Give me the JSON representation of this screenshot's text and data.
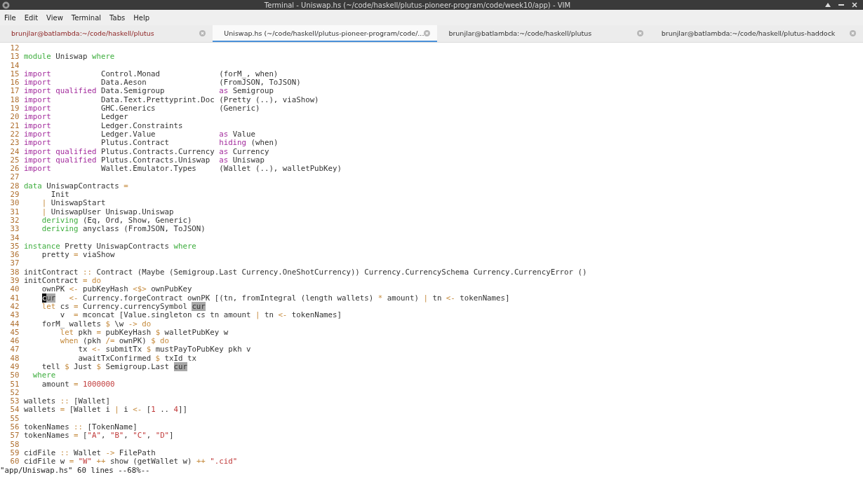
{
  "window": {
    "title": "Terminal - Uniswap.hs (~/code/haskell/plutus-pioneer-program/code/week10/app) - VIM"
  },
  "menu": [
    "File",
    "Edit",
    "View",
    "Terminal",
    "Tabs",
    "Help"
  ],
  "tabs": [
    {
      "label": "brunjlar@batlambda:~/code/haskell/plutus",
      "selected": false,
      "alert": true
    },
    {
      "label": "Uniswap.hs (~/code/haskell/plutus-pioneer-program/code/...",
      "selected": true,
      "alert": false
    },
    {
      "label": "brunjlar@batlambda:~/code/haskell/plutus",
      "selected": false,
      "alert": false
    },
    {
      "label": "brunjlar@batlambda:~/code/haskell/plutus-haddock",
      "selected": false,
      "alert": false
    }
  ],
  "lines": [
    {
      "n": "12"
    },
    {
      "n": "13",
      "segs": [
        {
          "kind": "decl",
          "text": "module"
        },
        {
          "kind": "plain",
          "text": " Uniswap "
        },
        {
          "kind": "decl",
          "text": "where"
        }
      ]
    },
    {
      "n": "14"
    },
    {
      "n": "15",
      "segs": [
        {
          "kind": "keyword",
          "text": "import"
        },
        {
          "kind": "plain",
          "text": "           Control.Monad             (forM_, when)"
        }
      ]
    },
    {
      "n": "16",
      "segs": [
        {
          "kind": "keyword",
          "text": "import"
        },
        {
          "kind": "plain",
          "text": "           Data.Aeson                (FromJSON, ToJSON)"
        }
      ]
    },
    {
      "n": "17",
      "segs": [
        {
          "kind": "keyword",
          "text": "import qualified"
        },
        {
          "kind": "plain",
          "text": " Data.Semigroup            "
        },
        {
          "kind": "keyword",
          "text": "as"
        },
        {
          "kind": "plain",
          "text": " Semigroup"
        }
      ]
    },
    {
      "n": "18",
      "segs": [
        {
          "kind": "keyword",
          "text": "import"
        },
        {
          "kind": "plain",
          "text": "           Data.Text.Prettyprint.Doc (Pretty (..), viaShow)"
        }
      ]
    },
    {
      "n": "19",
      "segs": [
        {
          "kind": "keyword",
          "text": "import"
        },
        {
          "kind": "plain",
          "text": "           GHC.Generics              (Generic)"
        }
      ]
    },
    {
      "n": "20",
      "segs": [
        {
          "kind": "keyword",
          "text": "import"
        },
        {
          "kind": "plain",
          "text": "           Ledger"
        }
      ]
    },
    {
      "n": "21",
      "segs": [
        {
          "kind": "keyword",
          "text": "import"
        },
        {
          "kind": "plain",
          "text": "           Ledger.Constraints"
        }
      ]
    },
    {
      "n": "22",
      "segs": [
        {
          "kind": "keyword",
          "text": "import"
        },
        {
          "kind": "plain",
          "text": "           Ledger.Value              "
        },
        {
          "kind": "keyword",
          "text": "as"
        },
        {
          "kind": "plain",
          "text": " Value"
        }
      ]
    },
    {
      "n": "23",
      "segs": [
        {
          "kind": "keyword",
          "text": "import"
        },
        {
          "kind": "plain",
          "text": "           Plutus.Contract           "
        },
        {
          "kind": "keyword",
          "text": "hiding"
        },
        {
          "kind": "plain",
          "text": " (when)"
        }
      ]
    },
    {
      "n": "24",
      "segs": [
        {
          "kind": "keyword",
          "text": "import qualified"
        },
        {
          "kind": "plain",
          "text": " Plutus.Contracts.Currency "
        },
        {
          "kind": "keyword",
          "text": "as"
        },
        {
          "kind": "plain",
          "text": " Currency"
        }
      ]
    },
    {
      "n": "25",
      "segs": [
        {
          "kind": "keyword",
          "text": "import qualified"
        },
        {
          "kind": "plain",
          "text": " Plutus.Contracts.Uniswap  "
        },
        {
          "kind": "keyword",
          "text": "as"
        },
        {
          "kind": "plain",
          "text": " Uniswap"
        }
      ]
    },
    {
      "n": "26",
      "segs": [
        {
          "kind": "keyword",
          "text": "import"
        },
        {
          "kind": "plain",
          "text": "           Wallet.Emulator.Types     (Wallet (..), walletPubKey)"
        }
      ]
    },
    {
      "n": "27"
    },
    {
      "n": "28",
      "segs": [
        {
          "kind": "decl",
          "text": "data"
        },
        {
          "kind": "plain",
          "text": " UniswapContracts "
        },
        {
          "kind": "op",
          "text": "="
        }
      ]
    },
    {
      "n": "29",
      "segs": [
        {
          "kind": "plain",
          "text": "      Init"
        }
      ]
    },
    {
      "n": "30",
      "segs": [
        {
          "kind": "op",
          "text": "    |"
        },
        {
          "kind": "plain",
          "text": " UniswapStart"
        }
      ]
    },
    {
      "n": "31",
      "segs": [
        {
          "kind": "op",
          "text": "    |"
        },
        {
          "kind": "plain",
          "text": " UniswapUser Uniswap.Uniswap"
        }
      ]
    },
    {
      "n": "32",
      "segs": [
        {
          "kind": "decl",
          "text": "    deriving"
        },
        {
          "kind": "plain",
          "text": " (Eq, Ord, Show, Generic)"
        }
      ]
    },
    {
      "n": "33",
      "segs": [
        {
          "kind": "decl",
          "text": "    deriving"
        },
        {
          "kind": "plain",
          "text": " anyclass (FromJSON, ToJSON)"
        }
      ]
    },
    {
      "n": "34"
    },
    {
      "n": "35",
      "segs": [
        {
          "kind": "decl",
          "text": "instance"
        },
        {
          "kind": "plain",
          "text": " Pretty UniswapContracts "
        },
        {
          "kind": "decl",
          "text": "where"
        }
      ]
    },
    {
      "n": "36",
      "segs": [
        {
          "kind": "plain",
          "text": "    pretty "
        },
        {
          "kind": "op",
          "text": "="
        },
        {
          "kind": "plain",
          "text": " viaShow"
        }
      ]
    },
    {
      "n": "37"
    },
    {
      "n": "38",
      "segs": [
        {
          "kind": "plain",
          "text": "initContract "
        },
        {
          "kind": "op",
          "text": "::"
        },
        {
          "kind": "plain",
          "text": " Contract (Maybe (Semigroup.Last Currency.OneShotCurrency)) Currency.CurrencySchema Currency.CurrencyError ()"
        }
      ]
    },
    {
      "n": "39",
      "segs": [
        {
          "kind": "plain",
          "text": "initContract "
        },
        {
          "kind": "op",
          "text": "= do"
        }
      ]
    },
    {
      "n": "40",
      "segs": [
        {
          "kind": "plain",
          "text": "    ownPK "
        },
        {
          "kind": "op",
          "text": "<-"
        },
        {
          "kind": "plain",
          "text": " pubKeyHash "
        },
        {
          "kind": "op",
          "text": "<$>"
        },
        {
          "kind": "plain",
          "text": " ownPubKey"
        }
      ]
    },
    {
      "n": "41",
      "indent": true,
      "segs": [
        {
          "kind": "cursor",
          "text": "c"
        },
        {
          "kind": "match",
          "text": "ur"
        },
        {
          "kind": "op",
          "text": "   <-"
        },
        {
          "kind": "plain",
          "text": " Currency.forgeContract ownPK [(tn, fromIntegral (length wallets) "
        },
        {
          "kind": "op",
          "text": "*"
        },
        {
          "kind": "plain",
          "text": " amount) "
        },
        {
          "kind": "op",
          "text": "|"
        },
        {
          "kind": "plain",
          "text": " tn "
        },
        {
          "kind": "op",
          "text": "<-"
        },
        {
          "kind": "plain",
          "text": " tokenNames]"
        }
      ]
    },
    {
      "n": "42",
      "segs": [
        {
          "kind": "op",
          "text": "    let"
        },
        {
          "kind": "plain",
          "text": " cs "
        },
        {
          "kind": "op",
          "text": "="
        },
        {
          "kind": "plain",
          "text": " Currency.currencySymbol "
        },
        {
          "kind": "match",
          "text": "cur"
        }
      ]
    },
    {
      "n": "43",
      "segs": [
        {
          "kind": "plain",
          "text": "        v  "
        },
        {
          "kind": "op",
          "text": "="
        },
        {
          "kind": "plain",
          "text": " mconcat [Value.singleton cs tn amount "
        },
        {
          "kind": "op",
          "text": "|"
        },
        {
          "kind": "plain",
          "text": " tn "
        },
        {
          "kind": "op",
          "text": "<-"
        },
        {
          "kind": "plain",
          "text": " tokenNames]"
        }
      ]
    },
    {
      "n": "44",
      "segs": [
        {
          "kind": "plain",
          "text": "    forM_ wallets "
        },
        {
          "kind": "op",
          "text": "$"
        },
        {
          "kind": "plain",
          "text": " \\w "
        },
        {
          "kind": "op",
          "text": "-> do"
        }
      ]
    },
    {
      "n": "45",
      "segs": [
        {
          "kind": "op",
          "text": "        let"
        },
        {
          "kind": "plain",
          "text": " pkh "
        },
        {
          "kind": "op",
          "text": "="
        },
        {
          "kind": "plain",
          "text": " pubKeyHash "
        },
        {
          "kind": "op",
          "text": "$"
        },
        {
          "kind": "plain",
          "text": " walletPubKey w"
        }
      ]
    },
    {
      "n": "46",
      "segs": [
        {
          "kind": "op",
          "text": "        when"
        },
        {
          "kind": "plain",
          "text": " (pkh "
        },
        {
          "kind": "op",
          "text": "/="
        },
        {
          "kind": "plain",
          "text": " ownPK) "
        },
        {
          "kind": "op",
          "text": "$ do"
        }
      ]
    },
    {
      "n": "47",
      "segs": [
        {
          "kind": "plain",
          "text": "            tx "
        },
        {
          "kind": "op",
          "text": "<-"
        },
        {
          "kind": "plain",
          "text": " submitTx "
        },
        {
          "kind": "op",
          "text": "$"
        },
        {
          "kind": "plain",
          "text": " mustPayToPubKey pkh v"
        }
      ]
    },
    {
      "n": "48",
      "segs": [
        {
          "kind": "plain",
          "text": "            awaitTxConfirmed "
        },
        {
          "kind": "op",
          "text": "$"
        },
        {
          "kind": "plain",
          "text": " txId tx"
        }
      ]
    },
    {
      "n": "49",
      "segs": [
        {
          "kind": "plain",
          "text": "    tell "
        },
        {
          "kind": "op",
          "text": "$"
        },
        {
          "kind": "plain",
          "text": " Just "
        },
        {
          "kind": "op",
          "text": "$"
        },
        {
          "kind": "plain",
          "text": " Semigroup.Last "
        },
        {
          "kind": "match",
          "text": "cur"
        }
      ]
    },
    {
      "n": "50",
      "segs": [
        {
          "kind": "decl",
          "text": "  where"
        }
      ]
    },
    {
      "n": "51",
      "segs": [
        {
          "kind": "plain",
          "text": "    amount "
        },
        {
          "kind": "op",
          "text": "="
        },
        {
          "kind": "literal",
          "text": " 1000000"
        }
      ]
    },
    {
      "n": "52"
    },
    {
      "n": "53",
      "segs": [
        {
          "kind": "plain",
          "text": "wallets "
        },
        {
          "kind": "op",
          "text": "::"
        },
        {
          "kind": "plain",
          "text": " [Wallet]"
        }
      ]
    },
    {
      "n": "54",
      "segs": [
        {
          "kind": "plain",
          "text": "wallets "
        },
        {
          "kind": "op",
          "text": "="
        },
        {
          "kind": "plain",
          "text": " [Wallet i "
        },
        {
          "kind": "op",
          "text": "|"
        },
        {
          "kind": "plain",
          "text": " i "
        },
        {
          "kind": "op",
          "text": "<-"
        },
        {
          "kind": "plain",
          "text": " ["
        },
        {
          "kind": "literal",
          "text": "1"
        },
        {
          "kind": "plain",
          "text": " .. "
        },
        {
          "kind": "literal",
          "text": "4"
        },
        {
          "kind": "plain",
          "text": "]]"
        }
      ]
    },
    {
      "n": "55"
    },
    {
      "n": "56",
      "segs": [
        {
          "kind": "plain",
          "text": "tokenNames "
        },
        {
          "kind": "op",
          "text": "::"
        },
        {
          "kind": "plain",
          "text": " [TokenName]"
        }
      ]
    },
    {
      "n": "57",
      "segs": [
        {
          "kind": "plain",
          "text": "tokenNames "
        },
        {
          "kind": "op",
          "text": "="
        },
        {
          "kind": "plain",
          "text": " ["
        },
        {
          "kind": "literal",
          "text": "\"A\""
        },
        {
          "kind": "plain",
          "text": ", "
        },
        {
          "kind": "literal",
          "text": "\"B\""
        },
        {
          "kind": "plain",
          "text": ", "
        },
        {
          "kind": "literal",
          "text": "\"C\""
        },
        {
          "kind": "plain",
          "text": ", "
        },
        {
          "kind": "literal",
          "text": "\"D\""
        },
        {
          "kind": "plain",
          "text": "]"
        }
      ]
    },
    {
      "n": "58"
    },
    {
      "n": "59",
      "segs": [
        {
          "kind": "plain",
          "text": "cidFile "
        },
        {
          "kind": "op",
          "text": "::"
        },
        {
          "kind": "plain",
          "text": " Wallet "
        },
        {
          "kind": "op",
          "text": "->"
        },
        {
          "kind": "plain",
          "text": " FilePath"
        }
      ]
    },
    {
      "n": "60",
      "segs": [
        {
          "kind": "plain",
          "text": "cidFile w "
        },
        {
          "kind": "op",
          "text": "="
        },
        {
          "kind": "literal",
          "text": " \"W\""
        },
        {
          "kind": "op",
          "text": " ++"
        },
        {
          "kind": "plain",
          "text": " show (getWallet w) "
        },
        {
          "kind": "op",
          "text": "++"
        },
        {
          "kind": "literal",
          "text": " \".cid\""
        }
      ]
    }
  ],
  "status_line": "\"app/Uniswap.hs\" 60 lines --68%--"
}
